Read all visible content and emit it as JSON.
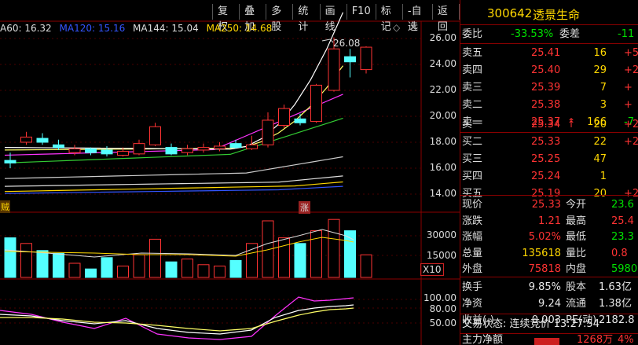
{
  "toolbar": [
    "复权",
    "叠加",
    "多股",
    "统计",
    "画线",
    "F10",
    "标记",
    "-自选",
    "返回"
  ],
  "ma_legend": [
    {
      "text": "A60: 16.32",
      "color": "#dddddd"
    },
    {
      "text": "MA120: 15.16",
      "color": "#3355ff"
    },
    {
      "text": "MA144: 15.04",
      "color": "#dddddd"
    },
    {
      "text": "MA250: 14.68",
      "color": "#ffd700"
    }
  ],
  "price_axis": [
    "26.00",
    "24.00",
    "22.00",
    "20.00",
    "18.00",
    "16.00",
    "14.00"
  ],
  "high_marker": "26.08",
  "volume_axis": [
    "30000",
    "15000"
  ],
  "volume_unit": "X10",
  "indicator_axis": [
    "100.00",
    "80.00",
    "50.00"
  ],
  "tag_left": "贼",
  "tag_rise": "涨",
  "stock": {
    "code": "300642",
    "name": "透景生命"
  },
  "weibi": {
    "label": "委比",
    "value": "-33.53%",
    "label2": "委差",
    "value2": "-11"
  },
  "asks": [
    {
      "label": "卖五",
      "price": "25.41",
      "vol": "16",
      "chg": "+5"
    },
    {
      "label": "卖四",
      "price": "25.40",
      "vol": "29",
      "chg": "+2"
    },
    {
      "label": "卖三",
      "price": "25.39",
      "vol": "7",
      "chg": "+"
    },
    {
      "label": "卖二",
      "price": "25.38",
      "vol": "3",
      "chg": "+"
    },
    {
      "label": "卖一",
      "price": "25.37",
      "vol": "166",
      "chg": "-7"
    }
  ],
  "bids": [
    {
      "label": "买一",
      "price": "25.34",
      "vol": "20",
      "chg": "+2"
    },
    {
      "label": "买二",
      "price": "25.33",
      "vol": "22",
      "chg": "+2"
    },
    {
      "label": "买三",
      "price": "25.25",
      "vol": "47",
      "chg": ""
    },
    {
      "label": "买四",
      "price": "25.24",
      "vol": "1",
      "chg": ""
    },
    {
      "label": "买五",
      "price": "25.19",
      "vol": "20",
      "chg": "+2"
    }
  ],
  "stats": [
    {
      "l1": "现价",
      "v1": "25.33",
      "l2": "今开",
      "v2": "23.6"
    },
    {
      "l1": "涨跌",
      "v1": "1.21",
      "l2": "最高",
      "v2": "25.4"
    },
    {
      "l1": "涨幅",
      "v1": "5.02%",
      "l2": "最低",
      "v2": "23.3"
    },
    {
      "l1": "总量",
      "v1": "135618",
      "l2": "量比",
      "v2": "0.8"
    },
    {
      "l1": "外盘",
      "v1": "75818",
      "l2": "内盘",
      "v2": "5980"
    }
  ],
  "stats2": [
    {
      "l1": "换手",
      "v1": "9.85%",
      "l2": "股本",
      "v2": "1.63亿"
    },
    {
      "l1": "净资",
      "v1": "9.24",
      "l2": "流通",
      "v2": "1.38亿"
    },
    {
      "l1": "收益(-)",
      "v1": "0.003",
      "l2": "PE(动)",
      "v2": "2182.8"
    }
  ],
  "trade_status": "交易状态: 连续竞价 13:27:54",
  "net_flow": {
    "label": "主力净额",
    "value": "1268万",
    "pct": "4%"
  }
}
